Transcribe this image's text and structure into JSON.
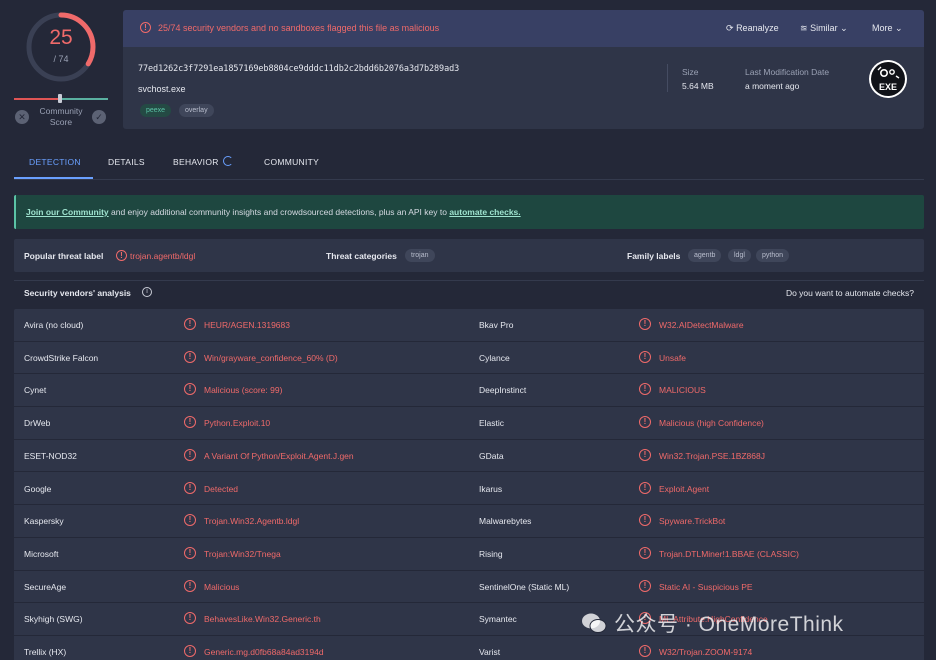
{
  "score": {
    "detections": "25",
    "total": "/ 74",
    "community_label": "Community\nScore",
    "ring_color": "#f06a6a"
  },
  "summary": {
    "alert": "25/74 security vendors and no sandboxes flagged this file as malicious",
    "reanalyze": "Reanalyze",
    "similar": "Similar",
    "more": "More",
    "hash": "77ed1262c3f7291ea1857169eb8804ce9dddc11db2c2bdd6b2076a3d7b289ad3",
    "filename": "svchost.exe",
    "tags": [
      "peexe",
      "overlay"
    ],
    "size_label": "Size",
    "size_value": "5.64 MB",
    "lastmod_label": "Last Modification Date",
    "lastmod_value": "a moment ago",
    "filetype_icon": "exe-file-icon",
    "filetype_text": "EXE"
  },
  "tabs": [
    "DETECTION",
    "DETAILS",
    "BEHAVIOR",
    "COMMUNITY"
  ],
  "banner": {
    "link1": "Join our Community",
    "mid": " and enjoy additional community insights and crowdsourced detections, plus an API key to ",
    "link2": "automate checks."
  },
  "threat": {
    "popular_label": "Popular threat label",
    "popular_value": "trojan.agentb/ldgl",
    "categories_label": "Threat categories",
    "categories": [
      "trojan"
    ],
    "family_label": "Family labels",
    "family": [
      "agentb",
      "ldgl",
      "python"
    ]
  },
  "vendors_section": {
    "title": "Security vendors' analysis",
    "automate": "Do you want to automate checks?"
  },
  "vendors": [
    {
      "left_name": "Avira (no cloud)",
      "left_result": "HEUR/AGEN.1319683",
      "right_name": "Bkav Pro",
      "right_result": "W32.AIDetectMalware"
    },
    {
      "left_name": "CrowdStrike Falcon",
      "left_result": "Win/grayware_confidence_60% (D)",
      "right_name": "Cylance",
      "right_result": "Unsafe"
    },
    {
      "left_name": "Cynet",
      "left_result": "Malicious (score: 99)",
      "right_name": "DeepInstinct",
      "right_result": "MALICIOUS"
    },
    {
      "left_name": "DrWeb",
      "left_result": "Python.Exploit.10",
      "right_name": "Elastic",
      "right_result": "Malicious (high Confidence)"
    },
    {
      "left_name": "ESET-NOD32",
      "left_result": "A Variant Of Python/Exploit.Agent.J.gen",
      "right_name": "GData",
      "right_result": "Win32.Trojan.PSE.1BZ868J"
    },
    {
      "left_name": "Google",
      "left_result": "Detected",
      "right_name": "Ikarus",
      "right_result": "Exploit.Agent"
    },
    {
      "left_name": "Kaspersky",
      "left_result": "Trojan.Win32.Agentb.ldgl",
      "right_name": "Malwarebytes",
      "right_result": "Spyware.TrickBot"
    },
    {
      "left_name": "Microsoft",
      "left_result": "Trojan:Win32/Tnega",
      "right_name": "Rising",
      "right_result": "Trojan.DTLMiner!1.BBAE (CLASSIC)"
    },
    {
      "left_name": "SecureAge",
      "left_result": "Malicious",
      "right_name": "SentinelOne (Static ML)",
      "right_result": "Static AI - Suspicious PE"
    },
    {
      "left_name": "Skyhigh (SWG)",
      "left_result": "BehavesLike.Win32.Generic.th",
      "right_name": "Symantec",
      "right_result": "ML.Attribute.HighConfidence"
    },
    {
      "left_name": "Trellix (HX)",
      "left_result": "Generic.mg.d0fb68a84ad3194d",
      "right_name": "Varist",
      "right_result": "W32/Trojan.ZOOM-9174"
    }
  ],
  "watermark": "公众号 · OneMoreThink",
  "colors": {
    "malicious": "#f06a6a",
    "accent": "#6aa0ff",
    "banner": "#1e4740"
  }
}
